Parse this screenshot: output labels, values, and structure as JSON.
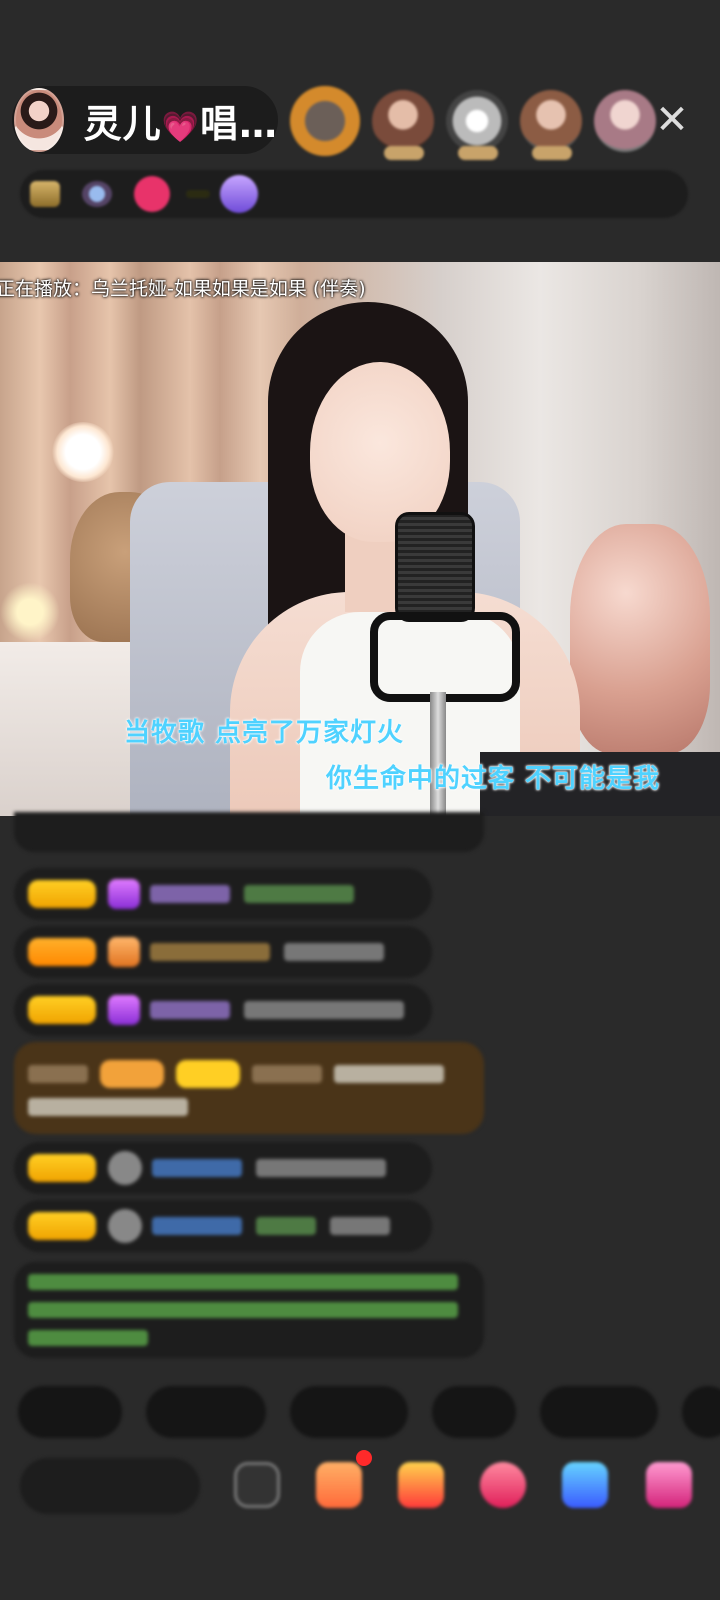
{
  "header": {
    "host_name": "灵儿",
    "host_name_suffix": "唱…",
    "heart_glyph": "💗",
    "close_glyph": "✕",
    "viewer_avatars": [
      "viewer-1",
      "viewer-2",
      "viewer-3",
      "viewer-4",
      "viewer-5"
    ]
  },
  "video": {
    "now_playing": "正在播放：乌兰托娅-如果如果是如果 (伴奏)",
    "lyric_line_1": "当牧歌  点亮了万家灯火",
    "lyric_line_2": "你生命中的过客  不可能是我"
  },
  "colors": {
    "background": "#2a2a2a",
    "lyric": "#4fd2ff",
    "badge_gold": "#ffcf24",
    "system_msg": "#6fd25a"
  }
}
